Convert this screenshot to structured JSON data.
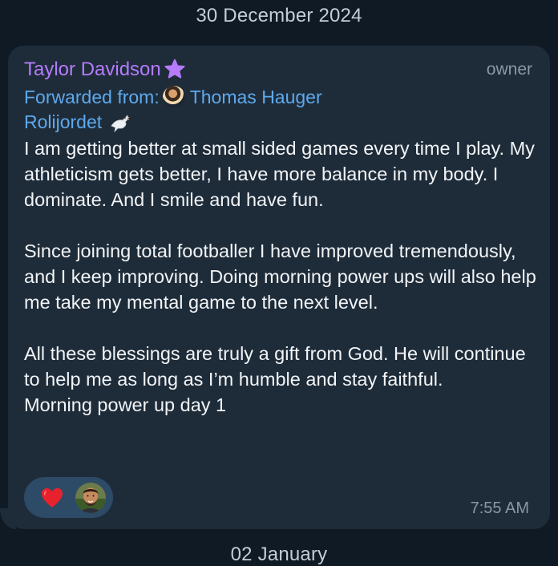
{
  "date_separator_top": "30 December 2024",
  "date_separator_bottom": "02 January",
  "message": {
    "sender": "Taylor Davidson",
    "sender_badge_icon": "star-icon",
    "role": "owner",
    "forward_prefix": "Forwarded from:",
    "forward_from": "Thomas Hauger",
    "signature": "Rolijordet",
    "signature_icon": "dove-icon",
    "text": "I am getting better at small sided games every time I play. My athleticism gets better, I have more balance in my body. I dominate. And I smile and have fun.\n\nSince joining total footballer I have improved tremendously, and I keep improving. Doing morning power ups will also help me take my mental game to the next level.\n\nAll these blessings are truly a gift from God. He will continue to help me as long as I’m humble and stay faithful.\nMorning power up day 1",
    "reaction": {
      "emoji_icon": "heart-icon",
      "reactor_avatar": "avatar"
    },
    "time": "7:55 AM"
  },
  "colors": {
    "background": "#0f1a25",
    "bubble": "#1e2c3a",
    "sender": "#b57bfc",
    "link": "#5ea9eb",
    "text": "#f2f4f6",
    "muted": "#8a97a5",
    "reaction_chip": "#2d4a66",
    "heart": "#e8222d"
  }
}
